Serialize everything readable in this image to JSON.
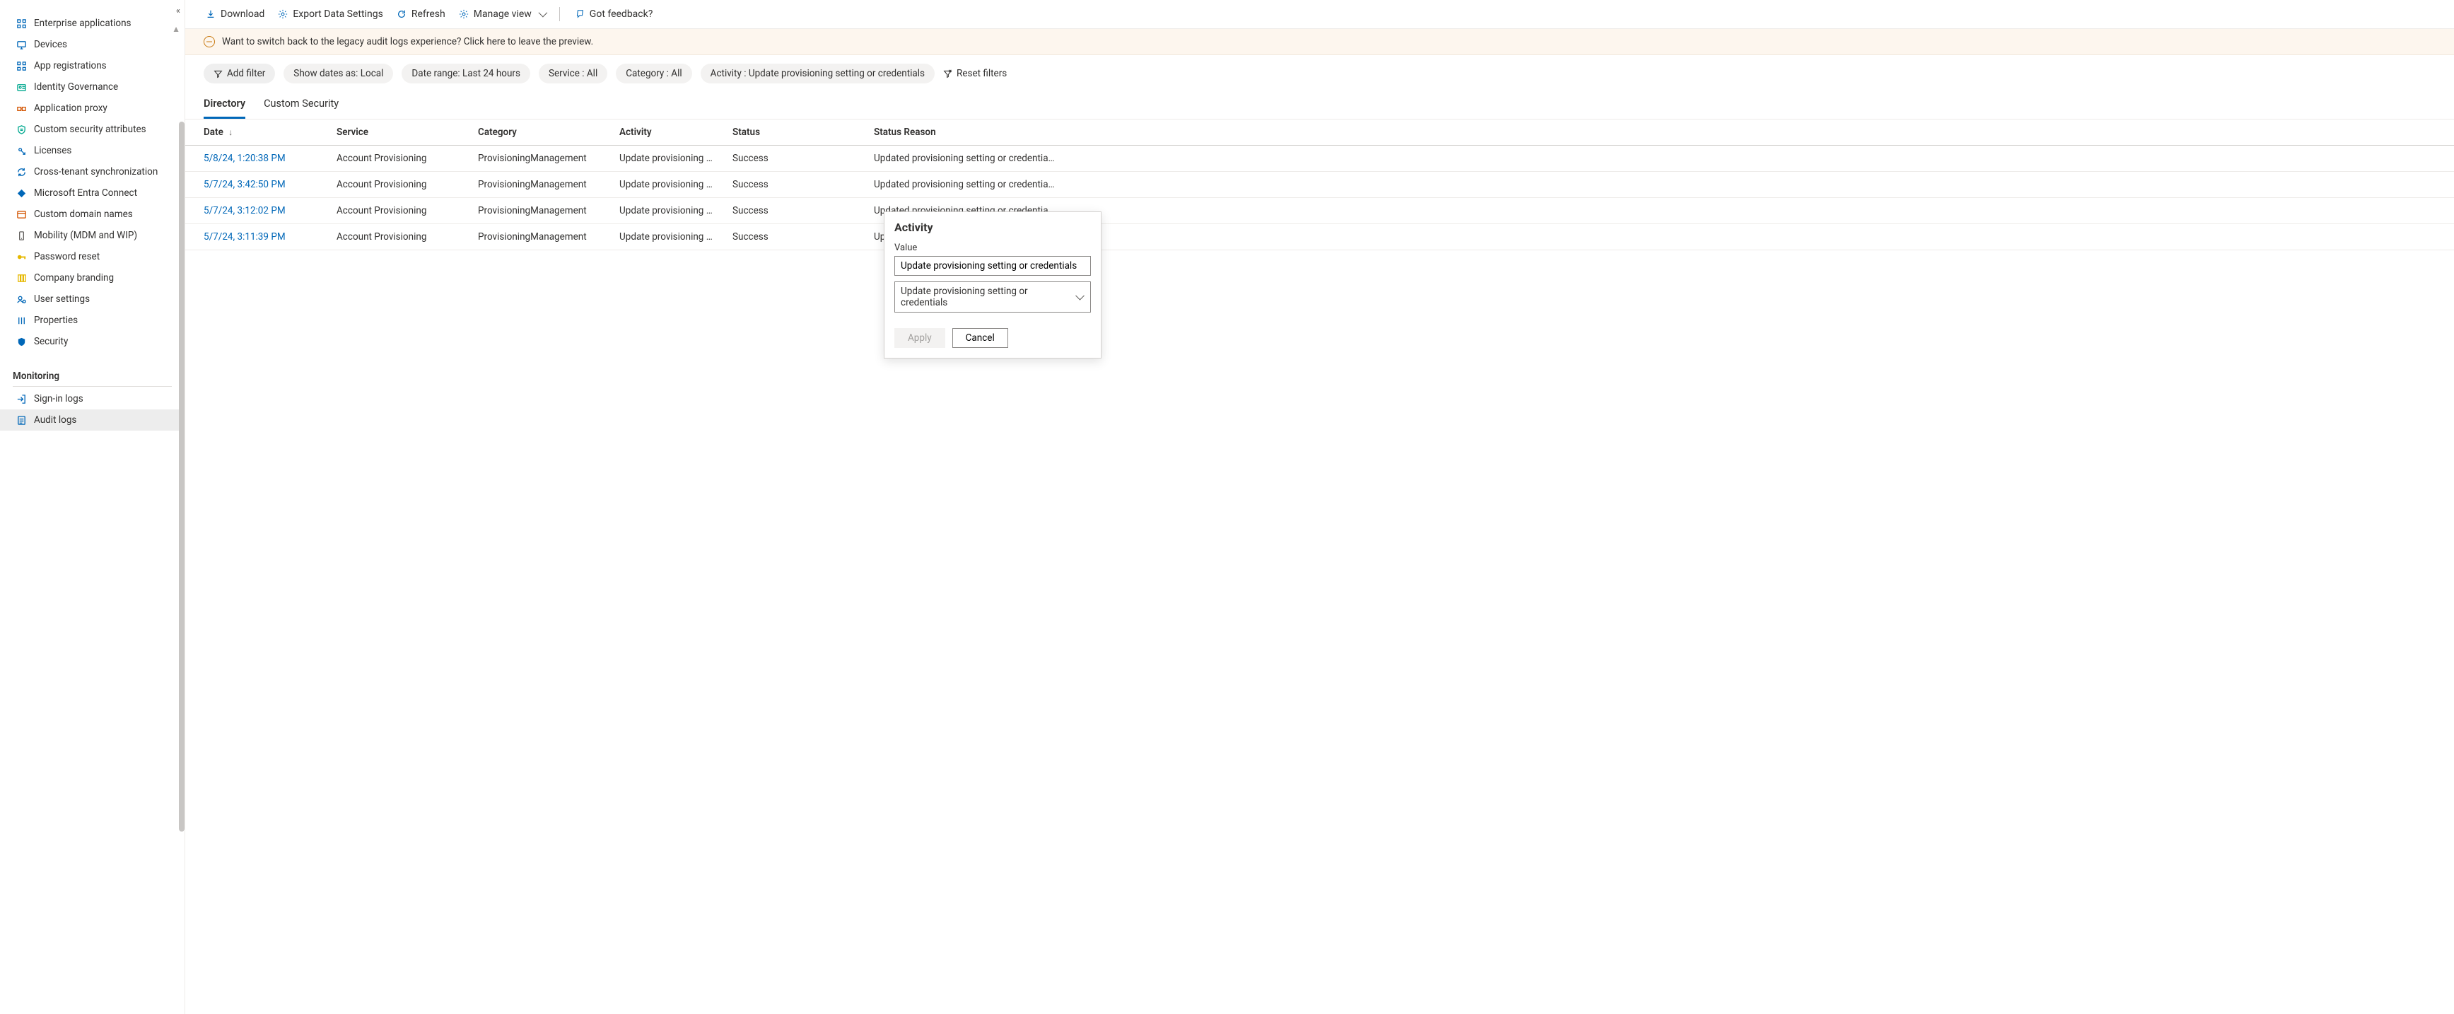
{
  "sidebar": {
    "items": [
      {
        "label": "Enterprise applications",
        "icon": "grid",
        "color": "#0067b8"
      },
      {
        "label": "Devices",
        "icon": "monitor",
        "color": "#0067b8"
      },
      {
        "label": "App registrations",
        "icon": "grid",
        "color": "#0067b8"
      },
      {
        "label": "Identity Governance",
        "icon": "id",
        "color": "#00a88f"
      },
      {
        "label": "Application proxy",
        "icon": "proxy",
        "color": "#d35400"
      },
      {
        "label": "Custom security attributes",
        "icon": "shield-list",
        "color": "#00a88f"
      },
      {
        "label": "Licenses",
        "icon": "license",
        "color": "#0067b8"
      },
      {
        "label": "Cross-tenant synchronization",
        "icon": "sync",
        "color": "#0067b8"
      },
      {
        "label": "Microsoft Entra Connect",
        "icon": "diamond",
        "color": "#0067b8"
      },
      {
        "label": "Custom domain names",
        "icon": "domain",
        "color": "#d35400"
      },
      {
        "label": "Mobility (MDM and WIP)",
        "icon": "mobile",
        "color": "#605e5c"
      },
      {
        "label": "Password reset",
        "icon": "key",
        "color": "#e6b800"
      },
      {
        "label": "Company branding",
        "icon": "palette",
        "color": "#e6b800"
      },
      {
        "label": "User settings",
        "icon": "user-gear",
        "color": "#0067b8"
      },
      {
        "label": "Properties",
        "icon": "props",
        "color": "#0067b8"
      },
      {
        "label": "Security",
        "icon": "shield",
        "color": "#0067b8"
      }
    ],
    "section": "Monitoring",
    "monitoring_items": [
      {
        "label": "Sign-in logs",
        "icon": "signin",
        "color": "#0067b8",
        "active": false
      },
      {
        "label": "Audit logs",
        "icon": "audit",
        "color": "#0067b8",
        "active": true
      }
    ]
  },
  "toolbar": {
    "download": "Download",
    "export": "Export Data Settings",
    "refresh": "Refresh",
    "manage": "Manage view",
    "feedback": "Got feedback?"
  },
  "banner": {
    "text": "Want to switch back to the legacy audit logs experience? Click here to leave the preview."
  },
  "filters": {
    "add": "Add filter",
    "pills": [
      "Show dates as: Local",
      "Date range: Last 24 hours",
      "Service : All",
      "Category : All",
      "Activity : Update provisioning setting or credentials"
    ],
    "reset": "Reset filters"
  },
  "tabs": [
    {
      "label": "Directory",
      "active": true
    },
    {
      "label": "Custom Security",
      "active": false
    }
  ],
  "table": {
    "headers": {
      "date": "Date",
      "service": "Service",
      "category": "Category",
      "activity": "Activity",
      "status": "Status",
      "statusReason": "Status Reason"
    },
    "rows": [
      {
        "date": "5/8/24, 1:20:38 PM",
        "service": "Account Provisioning",
        "category": "ProvisioningManagement",
        "activity": "Update provisioning set…",
        "status": "Success",
        "reason": "Updated provisioning setting or credentia…"
      },
      {
        "date": "5/7/24, 3:42:50 PM",
        "service": "Account Provisioning",
        "category": "ProvisioningManagement",
        "activity": "Update provisioning set…",
        "status": "Success",
        "reason": "Updated provisioning setting or credentia…"
      },
      {
        "date": "5/7/24, 3:12:02 PM",
        "service": "Account Provisioning",
        "category": "ProvisioningManagement",
        "activity": "Update provisioning set…",
        "status": "Success",
        "reason": "Updated provisioning setting or credentia…"
      },
      {
        "date": "5/7/24, 3:11:39 PM",
        "service": "Account Provisioning",
        "category": "ProvisioningManagement",
        "activity": "Update provisioning set…",
        "status": "Success",
        "reason": "Updated provisioning setting or credentia…"
      }
    ]
  },
  "popover": {
    "title": "Activity",
    "value_label": "Value",
    "input_value": "Update provisioning setting or credentials",
    "select_value": "Update provisioning setting or credentials",
    "apply": "Apply",
    "cancel": "Cancel"
  }
}
